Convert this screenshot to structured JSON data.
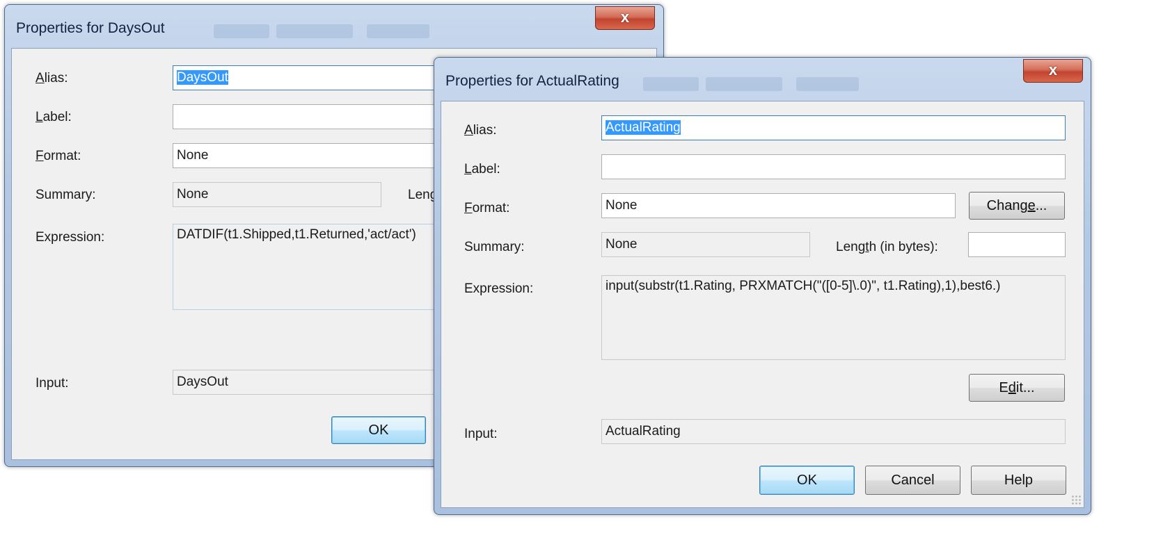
{
  "dialog1": {
    "title": "Properties for DaysOut",
    "close_glyph": "x",
    "alias_label_u": "A",
    "alias_label_rest": "lias:",
    "alias_value": "DaysOut",
    "label_label_u": "L",
    "label_label_rest": "abel:",
    "label_value": "",
    "format_label_u": "F",
    "format_label_rest": "ormat:",
    "format_value": "None",
    "summary_label": "Summary:",
    "summary_value": "None",
    "length_label_partial": "Leng",
    "expression_label": "Expression:",
    "expression_value": "DATDIF(t1.Shipped,t1.Returned,'act/act')",
    "input_label": "Input:",
    "input_value": "DaysOut",
    "ok_label": "OK"
  },
  "dialog2": {
    "title": "Properties for ActualRating",
    "close_glyph": "x",
    "alias_label_u": "A",
    "alias_label_rest": "lias:",
    "alias_value": "ActualRating",
    "label_label_u": "L",
    "label_label_rest": "abel:",
    "label_value": "",
    "format_label_u": "F",
    "format_label_rest": "ormat:",
    "format_value": "None",
    "change_pre": "Chang",
    "change_u": "e",
    "change_post": "...",
    "summary_label": "Summary:",
    "summary_value": "None",
    "length_pre": "Leng",
    "length_u": "t",
    "length_post": "h (in bytes):",
    "length_value": "",
    "expression_label": "Expression:",
    "expression_value": "input(substr(t1.Rating, PRXMATCH(\"([0-5]\\.0)\", t1.Rating),1),best6.)",
    "edit_pre": "E",
    "edit_u": "d",
    "edit_post": "it...",
    "input_label": "Input:",
    "input_value": "ActualRating",
    "ok_label": "OK",
    "cancel_label": "Cancel",
    "help_label": "Help"
  }
}
